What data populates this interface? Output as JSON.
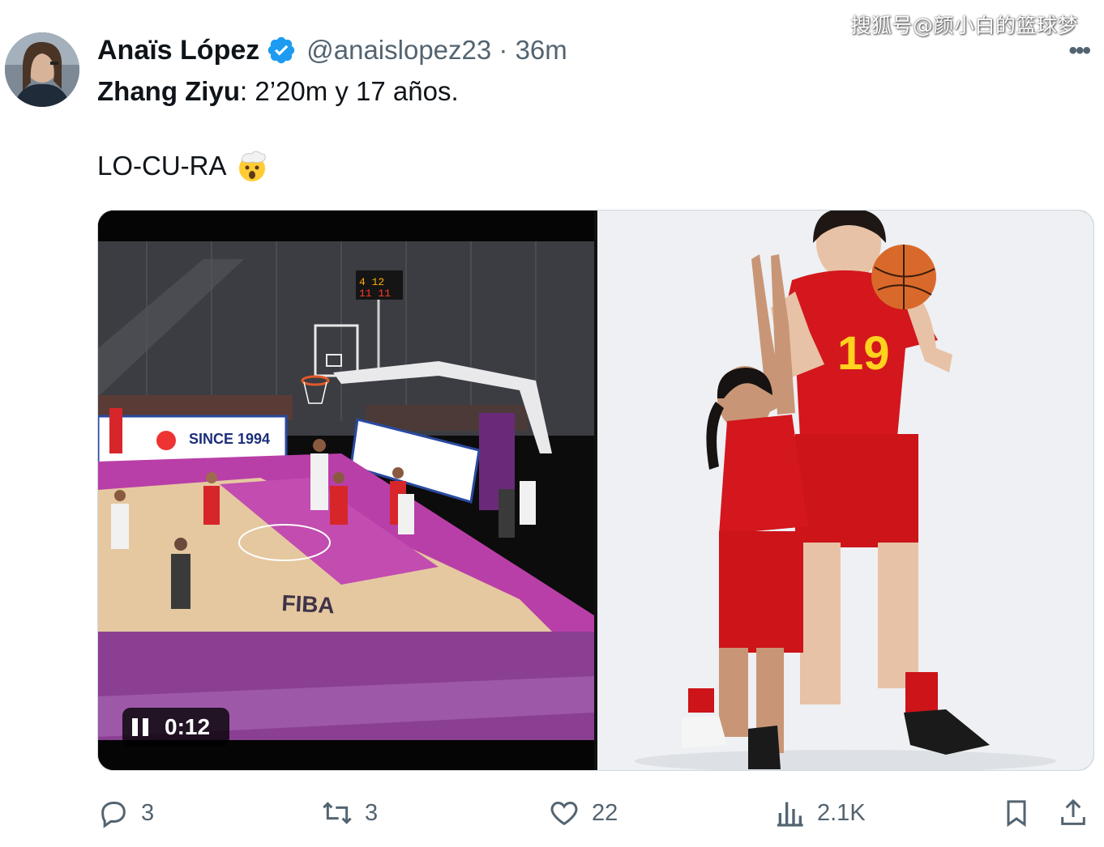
{
  "watermark": "搜狐号@颜小白的篮球梦",
  "tweet": {
    "display_name": "Anaïs López",
    "handle_time": "@anaislopez23 · 36m",
    "line1_bold": "Zhang Ziyu",
    "line1_rest": ": 2’20m y 17 años.",
    "line2": "LO-CU-RA",
    "more": "•••"
  },
  "video": {
    "timer": "0:12",
    "court_text": "FIBA",
    "banner_text": "SINCE 1994"
  },
  "photo": {
    "jersey_number": "19"
  },
  "actions": {
    "reply": "3",
    "retweet": "3",
    "like": "22",
    "views": "2.1K"
  },
  "colors": {
    "accent_blue": "#1d9bf0",
    "muted": "#536471",
    "court_purple": "#7a3e8e",
    "jersey_red": "#d3171c"
  }
}
